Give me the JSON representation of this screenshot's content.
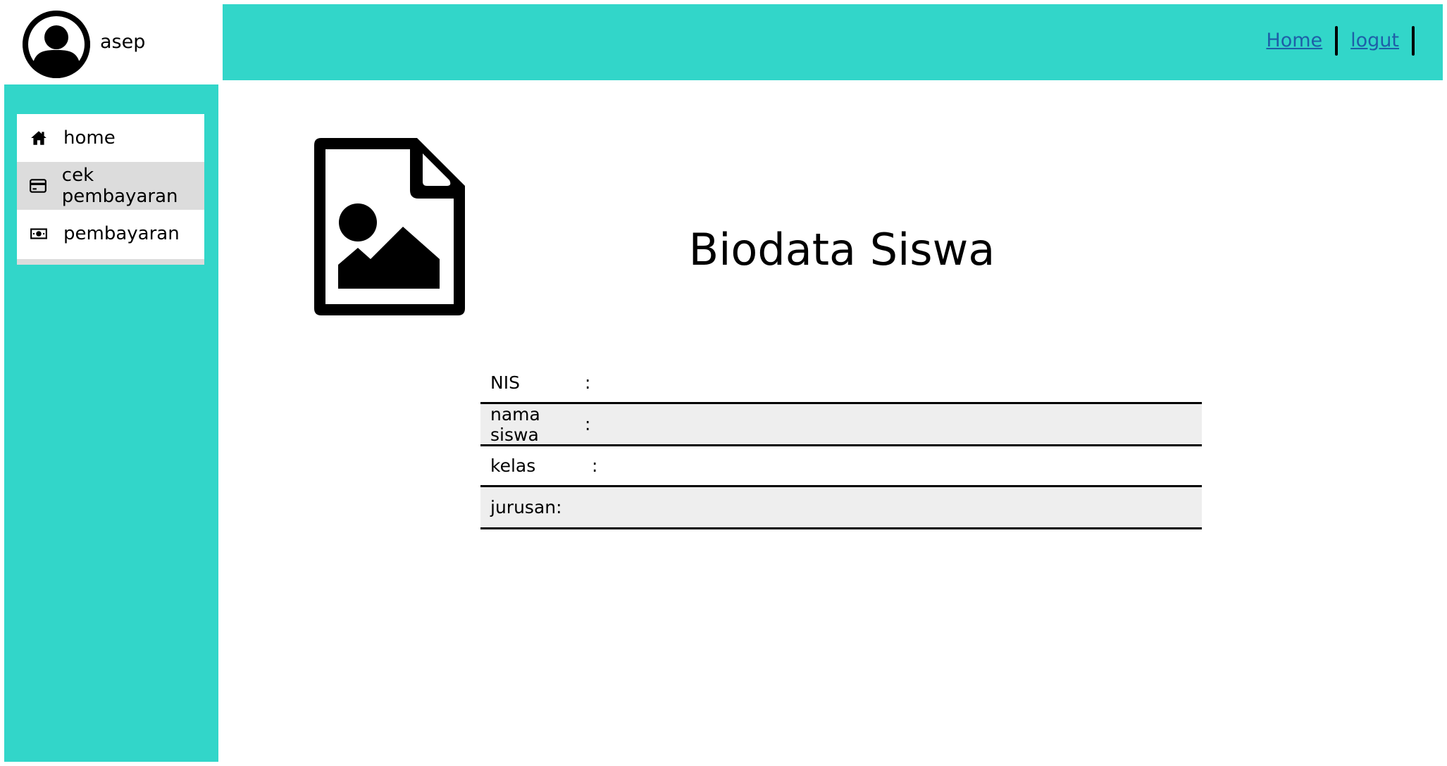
{
  "user": {
    "name": "asep",
    "avatar_icon": "user-avatar-icon"
  },
  "topbar": {
    "color": "#32d6c9",
    "links": [
      {
        "label": "Home"
      },
      {
        "label": "logut"
      }
    ]
  },
  "sidebar": {
    "color": "#32d6c9",
    "items": [
      {
        "label": "home",
        "icon": "home-icon"
      },
      {
        "label": "cek pembayaran",
        "icon": "credit-card-icon",
        "active": true
      },
      {
        "label": "pembayaran",
        "icon": "money-icon"
      }
    ]
  },
  "main": {
    "image_icon": "image-file-icon",
    "title": "Biodata Siswa",
    "fields": [
      {
        "label": "NIS",
        "colon": ":"
      },
      {
        "label": "nama siswa",
        "colon": ":"
      },
      {
        "label": "kelas",
        "colon": ":"
      },
      {
        "label": "jurusan",
        "colon": ":"
      }
    ]
  }
}
